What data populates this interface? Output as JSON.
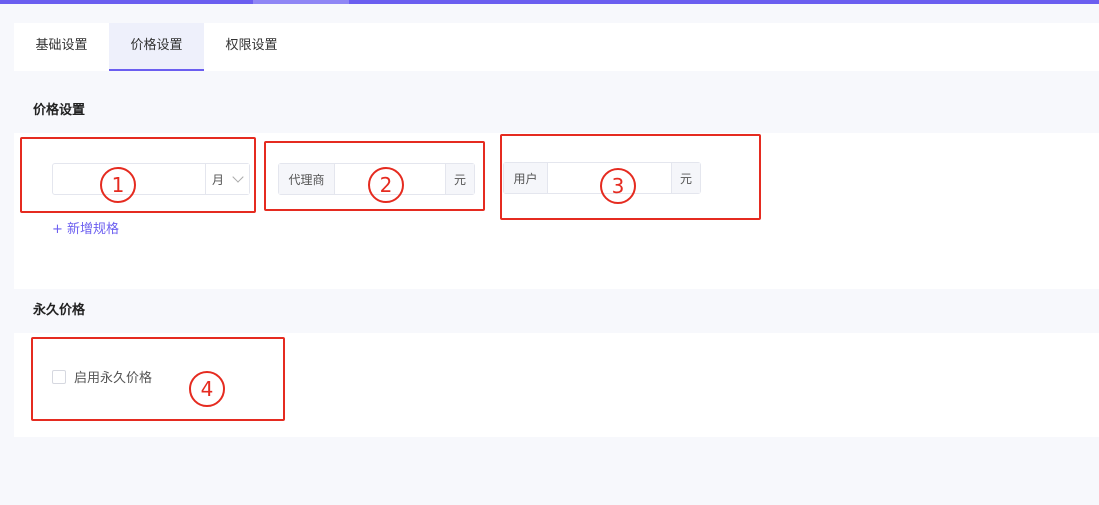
{
  "tabs": [
    {
      "label": "基础设置"
    },
    {
      "label": "价格设置"
    },
    {
      "label": "权限设置"
    }
  ],
  "active_tab": "价格设置",
  "price_section": {
    "title": "价格设置",
    "duration": {
      "value": "",
      "unit": "月"
    },
    "agent_price": {
      "prefix": "代理商",
      "value": "",
      "suffix": "元"
    },
    "user_price": {
      "prefix": "用户",
      "value": "",
      "suffix": "元"
    },
    "add_spec_label": "+ 新增规格"
  },
  "permanent_section": {
    "title": "永久价格",
    "checkbox_label": "启用永久价格",
    "checked": false
  },
  "annotations": [
    "1",
    "2",
    "3",
    "4"
  ],
  "colors": {
    "accent": "#6b5ef0",
    "annotation": "#e52b20"
  }
}
